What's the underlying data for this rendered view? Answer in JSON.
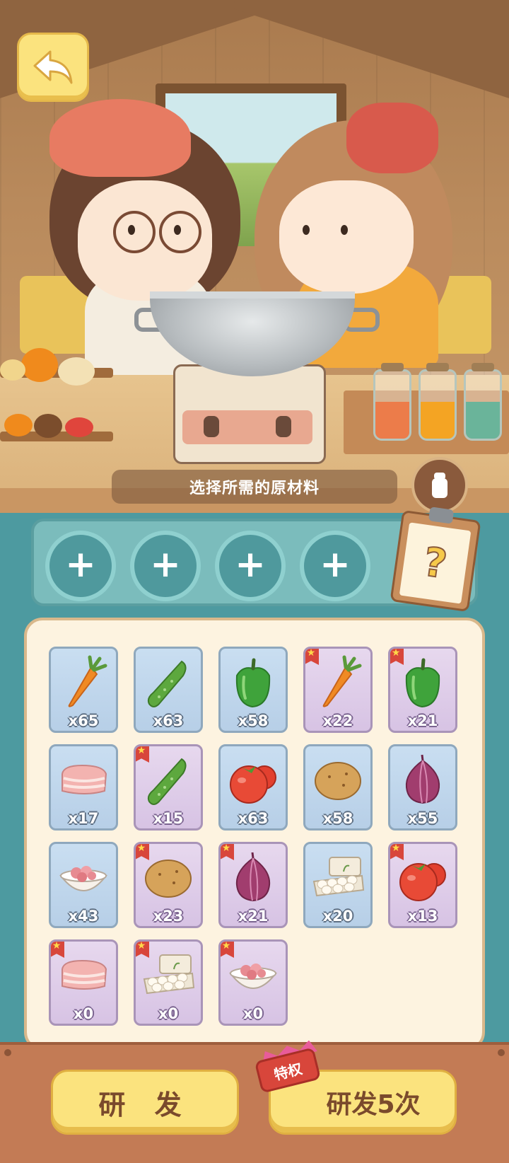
{
  "header": {
    "back_button": "back-arrow-icon"
  },
  "prompt": {
    "text": "选择所需的原材料"
  },
  "slots": [
    {
      "label": "+"
    },
    {
      "label": "+"
    },
    {
      "label": "+"
    },
    {
      "label": "+"
    }
  ],
  "recipe_book": {
    "symbol": "?"
  },
  "ingredients": [
    {
      "icon": "carrot",
      "count": "x65",
      "rare": false
    },
    {
      "icon": "cucumber",
      "count": "x63",
      "rare": false
    },
    {
      "icon": "green-pepper",
      "count": "x58",
      "rare": false
    },
    {
      "icon": "carrot",
      "count": "x22",
      "rare": true
    },
    {
      "icon": "green-pepper",
      "count": "x21",
      "rare": true
    },
    {
      "icon": "pork-belly",
      "count": "x17",
      "rare": false
    },
    {
      "icon": "cucumber",
      "count": "x15",
      "rare": true
    },
    {
      "icon": "tomato",
      "count": "x63",
      "rare": false
    },
    {
      "icon": "potato",
      "count": "x58",
      "rare": false
    },
    {
      "icon": "onion",
      "count": "x55",
      "rare": false
    },
    {
      "icon": "minced-meat",
      "count": "x43",
      "rare": false
    },
    {
      "icon": "potato",
      "count": "x23",
      "rare": true
    },
    {
      "icon": "onion",
      "count": "x21",
      "rare": true
    },
    {
      "icon": "eggs",
      "count": "x20",
      "rare": false
    },
    {
      "icon": "tomato",
      "count": "x13",
      "rare": true
    },
    {
      "icon": "pork-belly",
      "count": "x0",
      "rare": true
    },
    {
      "icon": "eggs",
      "count": "x0",
      "rare": true
    },
    {
      "icon": "minced-meat",
      "count": "x0",
      "rare": true
    }
  ],
  "buttons": {
    "develop": "研 发",
    "develop_5": "研发5次",
    "privilege_badge": "特权"
  }
}
